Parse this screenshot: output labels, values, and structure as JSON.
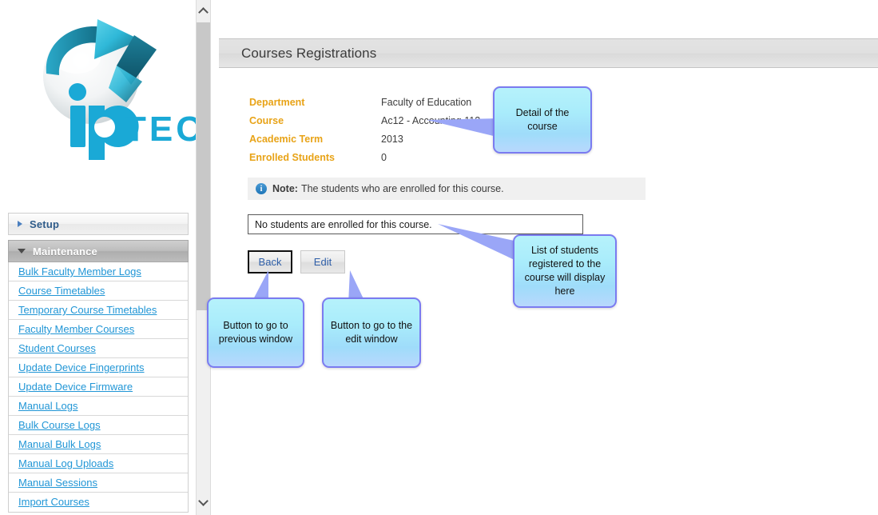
{
  "brand": {
    "name": "ipTECH",
    "word": "TECH",
    "accent": "#29b6d8",
    "dark": "#1c7f96"
  },
  "sidebar": {
    "groups": [
      {
        "label": "Setup",
        "expanded": false,
        "icon": "triangle-right-icon",
        "items": []
      },
      {
        "label": "Maintenance",
        "expanded": true,
        "icon": "triangle-down-icon",
        "items": [
          "Bulk Faculty Member Logs",
          "Course Timetables",
          "Temporary Course Timetables",
          "Faculty Member Courses",
          "Student Courses",
          "Update Device Fingerprints",
          "Update Device Firmware",
          "Manual Logs",
          "Bulk Course Logs",
          "Manual Bulk Logs",
          "Manual Log Uploads",
          "Manual Sessions",
          "Import Courses"
        ]
      }
    ],
    "link_color": "#2196d6"
  },
  "scrollbar": {
    "up_icon": "chevron-up-icon",
    "down_icon": "chevron-down-icon",
    "thumb": "scroll-thumb"
  },
  "header": {
    "title": "Courses Registrations"
  },
  "details": {
    "rows": [
      {
        "label": "Department",
        "value": "Faculty of Education"
      },
      {
        "label": "Course",
        "value": "Ac12 - Accounting 112"
      },
      {
        "label": "Academic Term",
        "value": "2013"
      },
      {
        "label": "Enrolled Students",
        "value": "0"
      }
    ],
    "label_color": "#e8a317"
  },
  "note": {
    "icon": "info-icon",
    "icon_glyph": "i",
    "strong": "Note:",
    "text": "The students who are enrolled for this course."
  },
  "students_list": {
    "empty_text": "No students are enrolled for this course."
  },
  "buttons": {
    "back": "Back",
    "edit": "Edit"
  },
  "callouts": {
    "detail": "Detail of the course",
    "list": "List of students registered to the course will display here",
    "back": "Button to go to previous window",
    "edit": "Button to go to the edit window",
    "border_color": "#7b7bf0"
  }
}
